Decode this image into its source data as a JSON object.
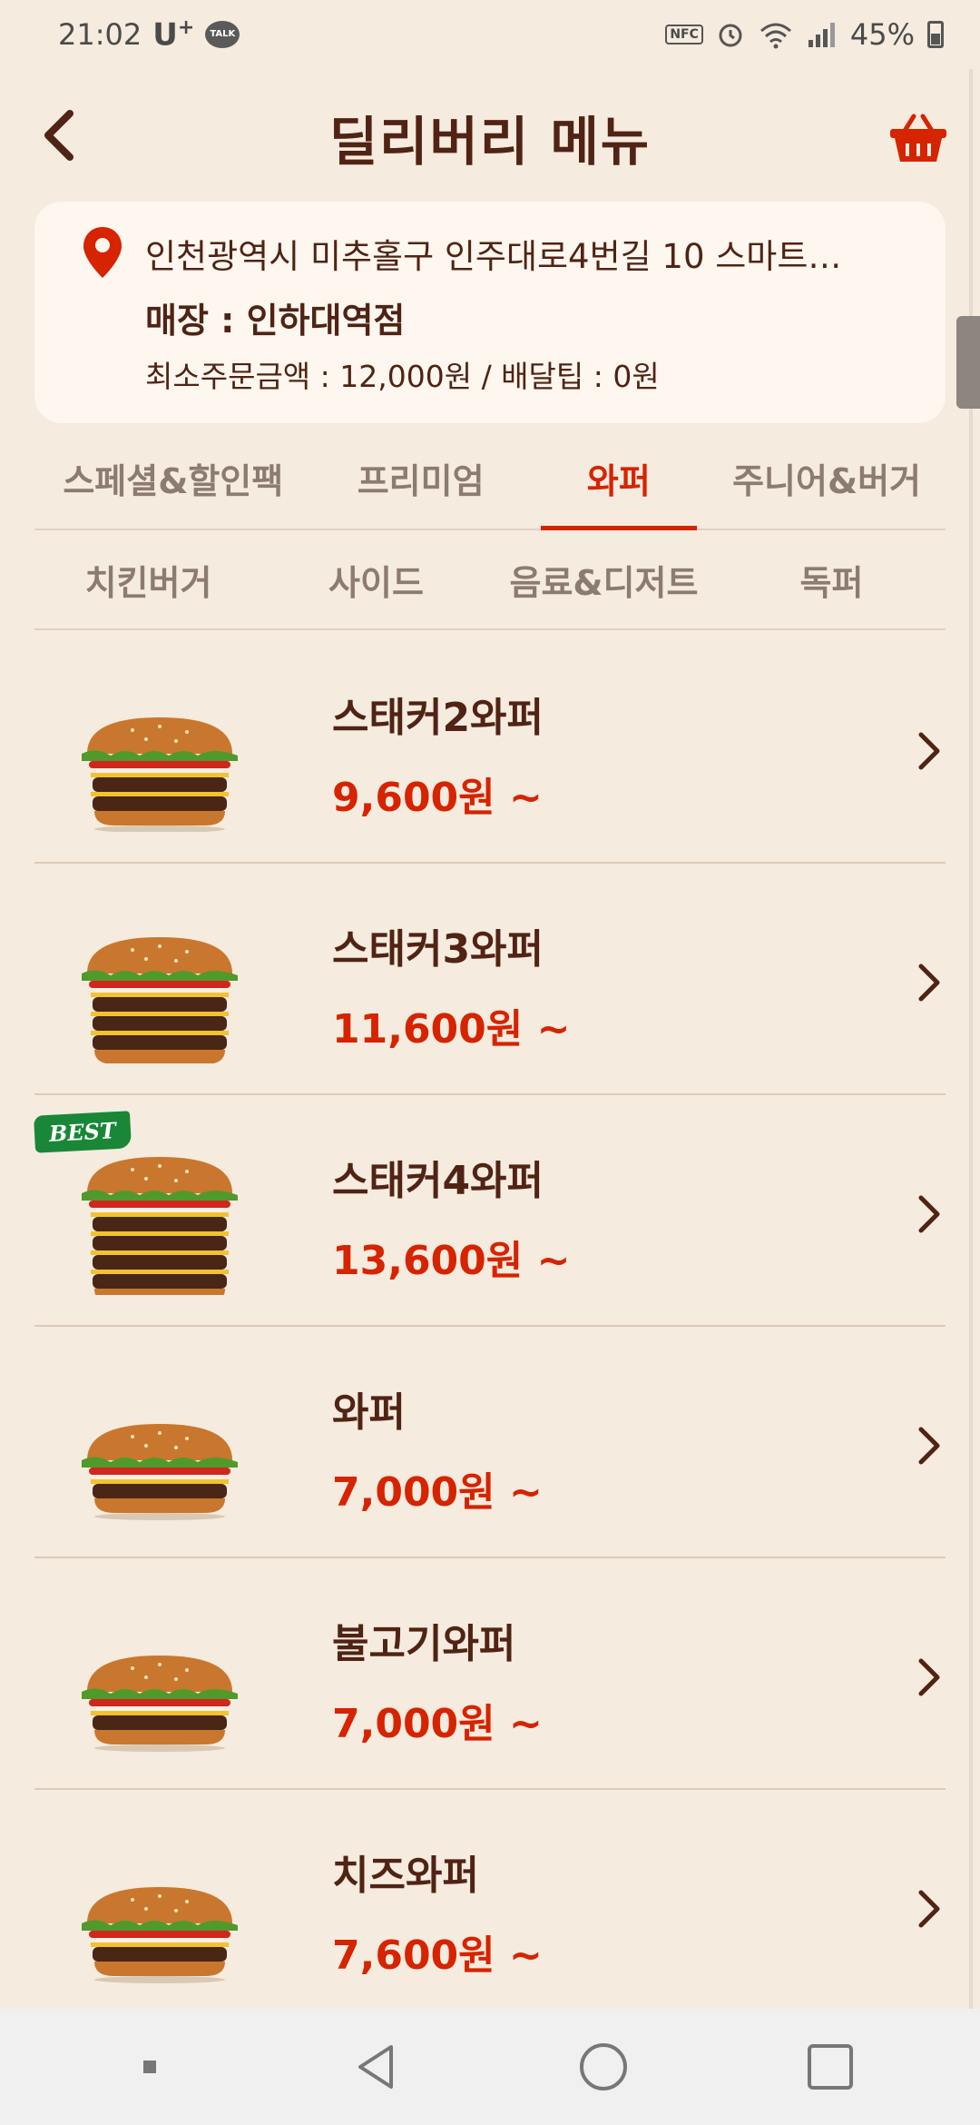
{
  "status_bar": {
    "time": "21:02",
    "carrier": "U",
    "carrier_sup": "+",
    "talk_label": "TALK",
    "nfc_label": "NFC",
    "battery": "45%"
  },
  "header": {
    "title": "딜리버리 메뉴"
  },
  "address_card": {
    "address": "인천광역시 미추홀구 인주대로4번길 10 스마트…",
    "store": "매장 : 인하대역점",
    "min_order": "최소주문금액 : 12,000원 / 배달팁 : 0원"
  },
  "tabs_row1": [
    {
      "label": "스페셜&할인팩",
      "active": false
    },
    {
      "label": "프리미엄",
      "active": false
    },
    {
      "label": "와퍼",
      "active": true
    },
    {
      "label": "주니어&버거",
      "active": false
    }
  ],
  "tabs_row2": [
    {
      "label": "치킨버거",
      "active": false
    },
    {
      "label": "사이드",
      "active": false
    },
    {
      "label": "음료&디저트",
      "active": false
    },
    {
      "label": "독퍼",
      "active": false
    }
  ],
  "menu_items": [
    {
      "name": "스태커2와퍼",
      "price": "9,600원 ~",
      "badge": "",
      "patties": 2
    },
    {
      "name": "스태커3와퍼",
      "price": "11,600원 ~",
      "badge": "",
      "patties": 3
    },
    {
      "name": "스태커4와퍼",
      "price": "13,600원 ~",
      "badge": "BEST",
      "patties": 4
    },
    {
      "name": "와퍼",
      "price": "7,000원 ~",
      "badge": "",
      "patties": 1
    },
    {
      "name": "불고기와퍼",
      "price": "7,000원 ~",
      "badge": "",
      "patties": 1
    },
    {
      "name": "치즈와퍼",
      "price": "7,600원 ~",
      "badge": "",
      "patties": 1
    }
  ],
  "colors": {
    "background": "#f5ebde",
    "brown": "#502314",
    "accent_red": "#d62300",
    "card": "#fdf7ef",
    "best_green": "#198737"
  },
  "icons": {
    "back": "chevron-left-icon",
    "cart": "basket-icon",
    "pin": "location-pin-icon",
    "arrow": "chevron-right-icon"
  }
}
